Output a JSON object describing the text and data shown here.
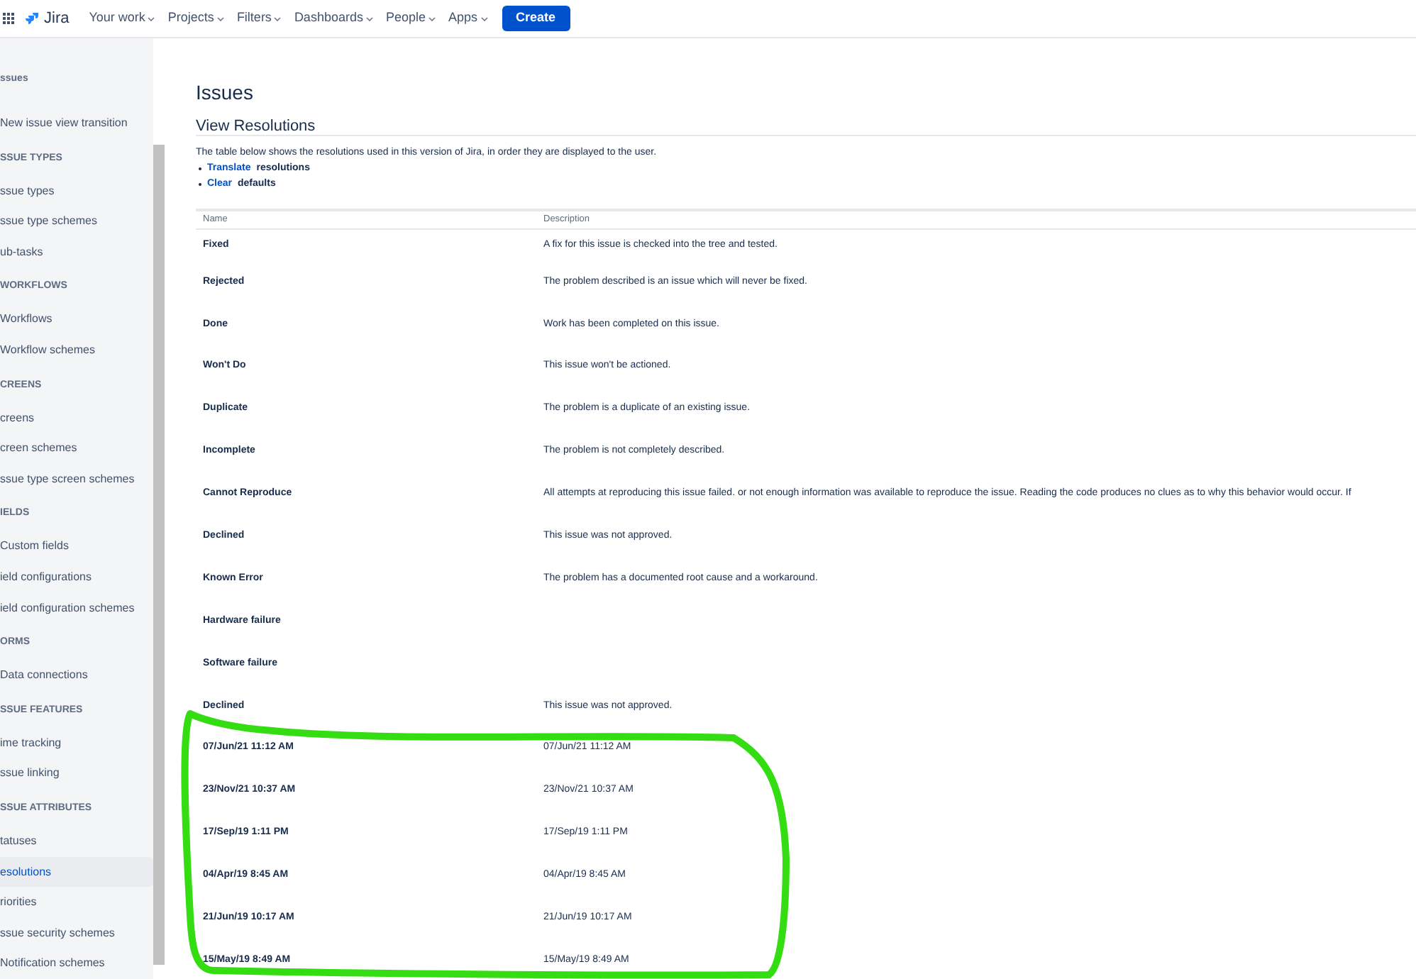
{
  "nav": {
    "product": "Jira",
    "menus": [
      {
        "label": "Your work"
      },
      {
        "label": "Projects"
      },
      {
        "label": "Filters"
      },
      {
        "label": "Dashboards"
      },
      {
        "label": "People"
      },
      {
        "label": "Apps"
      }
    ],
    "create": "Create"
  },
  "sidebar": {
    "sections": [
      {
        "heading": "ssues",
        "items": [
          {
            "label": "New issue view transition",
            "selected": false
          }
        ]
      },
      {
        "heading": "SSUE TYPES",
        "items": [
          {
            "label": "ssue types",
            "selected": false
          },
          {
            "label": "ssue type schemes",
            "selected": false
          },
          {
            "label": "ub-tasks",
            "selected": false
          }
        ]
      },
      {
        "heading": "WORKFLOWS",
        "items": [
          {
            "label": "Workflows",
            "selected": false
          },
          {
            "label": "Workflow schemes",
            "selected": false
          }
        ]
      },
      {
        "heading": "CREENS",
        "items": [
          {
            "label": "creens",
            "selected": false
          },
          {
            "label": "creen schemes",
            "selected": false
          },
          {
            "label": "ssue type screen schemes",
            "selected": false
          }
        ]
      },
      {
        "heading": "IELDS",
        "items": [
          {
            "label": "Custom fields",
            "selected": false
          },
          {
            "label": "ield configurations",
            "selected": false
          },
          {
            "label": "ield configuration schemes",
            "selected": false
          }
        ]
      },
      {
        "heading": "ORMS",
        "items": [
          {
            "label": "Data connections",
            "selected": false
          }
        ]
      },
      {
        "heading": "SSUE FEATURES",
        "items": [
          {
            "label": "ime tracking",
            "selected": false
          },
          {
            "label": "ssue linking",
            "selected": false
          }
        ]
      },
      {
        "heading": "SSUE ATTRIBUTES",
        "items": [
          {
            "label": "tatuses",
            "selected": false
          },
          {
            "label": "esolutions",
            "selected": true
          },
          {
            "label": "riorities",
            "selected": false
          },
          {
            "label": "ssue security schemes",
            "selected": false
          },
          {
            "label": "Notification schemes",
            "selected": false
          }
        ]
      }
    ]
  },
  "page": {
    "title": "Issues",
    "subtitle": "View Resolutions",
    "intro": "The table below shows the resolutions used in this version of Jira, in order they are displayed to the user.",
    "actions": [
      {
        "link": "Translate",
        "text": "resolutions"
      },
      {
        "link": "Clear",
        "text": "defaults"
      }
    ]
  },
  "table": {
    "columns": [
      "Name",
      "Description"
    ],
    "rows": [
      {
        "name": "Fixed",
        "description": "A fix for this issue is checked into the tree and tested."
      },
      {
        "name": "Rejected",
        "description": "The problem described is an issue which will never be fixed."
      },
      {
        "name": "Done",
        "description": "Work has been completed on this issue."
      },
      {
        "name": "Won't Do",
        "description": "This issue won't be actioned."
      },
      {
        "name": "Duplicate",
        "description": "The problem is a duplicate of an existing issue."
      },
      {
        "name": "Incomplete",
        "description": "The problem is not completely described."
      },
      {
        "name": "Cannot Reproduce",
        "description": "All attempts at reproducing this issue failed. or not enough information was available to reproduce the issue. Reading the code produces no clues as to why this behavior would occur. If"
      },
      {
        "name": "Declined",
        "description": "This issue was not approved."
      },
      {
        "name": "Known Error",
        "description": "The problem has a documented root cause and a workaround."
      },
      {
        "name": "Hardware failure",
        "description": ""
      },
      {
        "name": "Software failure",
        "description": ""
      },
      {
        "name": "Declined",
        "description": "This issue was not approved."
      },
      {
        "name": "07/Jun/21 11:12 AM",
        "description": "07/Jun/21 11:12 AM"
      },
      {
        "name": "23/Nov/21 10:37 AM",
        "description": "23/Nov/21 10:37 AM"
      },
      {
        "name": "17/Sep/19 1:11 PM",
        "description": "17/Sep/19 1:11 PM"
      },
      {
        "name": "04/Apr/19 8:45 AM",
        "description": "04/Apr/19 8:45 AM"
      },
      {
        "name": "21/Jun/19 10:17 AM",
        "description": "21/Jun/19 10:17 AM"
      },
      {
        "name": "15/May/19 8:49 AM",
        "description": "15/May/19 8:49 AM"
      }
    ]
  }
}
